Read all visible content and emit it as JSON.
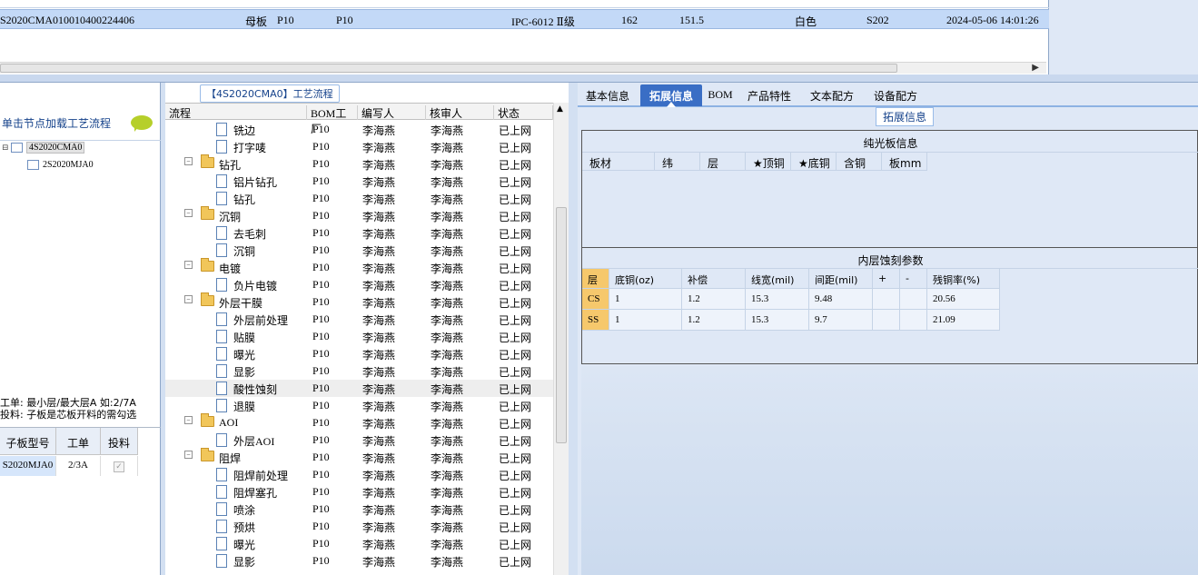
{
  "top_grid": {
    "row": {
      "code": "S2020CMA0",
      "id": "10010400224406",
      "board_type": "母板",
      "p1": "P10",
      "p2": "P10",
      "grade": "IPC-6012 Ⅱ级",
      "n1": "162",
      "n2": "151.5",
      "color": "白色",
      "s": "S202",
      "datetime": "2024-05-06 14:01:26"
    }
  },
  "left": {
    "title": "单击节点加载工艺流程",
    "tree": [
      {
        "label": "4S2020CMA0"
      },
      {
        "label": "2S2020MJA0"
      }
    ],
    "note1": "工单: 最小层/最大层A 如:2/7A",
    "note2": "投料: 子板是芯板开料的需勾选",
    "sub_headers": [
      "子板型号",
      "工单",
      "投料"
    ],
    "sub_row": {
      "model": "S2020MJA0",
      "order": "2/3A"
    }
  },
  "middle": {
    "legend": "【4S2020CMA0】工艺流程",
    "headers": [
      "流程",
      "BOM工厂",
      "编写人",
      "核审人",
      "状态"
    ],
    "rows": [
      {
        "name": "铣边",
        "level": 2,
        "bom": "P10",
        "writer": "李海燕",
        "reviewer": "李海燕",
        "status": "已上网"
      },
      {
        "name": "打字唛",
        "level": 2,
        "bom": "P10",
        "writer": "李海燕",
        "reviewer": "李海燕",
        "status": "已上网"
      },
      {
        "name": "钻孔",
        "level": 1,
        "bom": "P10",
        "writer": "李海燕",
        "reviewer": "李海燕",
        "status": "已上网"
      },
      {
        "name": "铝片钻孔",
        "level": 2,
        "bom": "P10",
        "writer": "李海燕",
        "reviewer": "李海燕",
        "status": "已上网"
      },
      {
        "name": "钻孔",
        "level": 2,
        "bom": "P10",
        "writer": "李海燕",
        "reviewer": "李海燕",
        "status": "已上网"
      },
      {
        "name": "沉铜",
        "level": 1,
        "bom": "P10",
        "writer": "李海燕",
        "reviewer": "李海燕",
        "status": "已上网"
      },
      {
        "name": "去毛刺",
        "level": 2,
        "bom": "P10",
        "writer": "李海燕",
        "reviewer": "李海燕",
        "status": "已上网"
      },
      {
        "name": "沉铜",
        "level": 2,
        "bom": "P10",
        "writer": "李海燕",
        "reviewer": "李海燕",
        "status": "已上网"
      },
      {
        "name": "电镀",
        "level": 1,
        "bom": "P10",
        "writer": "李海燕",
        "reviewer": "李海燕",
        "status": "已上网"
      },
      {
        "name": "负片电镀",
        "level": 2,
        "bom": "P10",
        "writer": "李海燕",
        "reviewer": "李海燕",
        "status": "已上网"
      },
      {
        "name": "外层干膜",
        "level": 1,
        "bom": "P10",
        "writer": "李海燕",
        "reviewer": "李海燕",
        "status": "已上网"
      },
      {
        "name": "外层前处理",
        "level": 2,
        "bom": "P10",
        "writer": "李海燕",
        "reviewer": "李海燕",
        "status": "已上网"
      },
      {
        "name": "贴膜",
        "level": 2,
        "bom": "P10",
        "writer": "李海燕",
        "reviewer": "李海燕",
        "status": "已上网"
      },
      {
        "name": "曝光",
        "level": 2,
        "bom": "P10",
        "writer": "李海燕",
        "reviewer": "李海燕",
        "status": "已上网"
      },
      {
        "name": "显影",
        "level": 2,
        "bom": "P10",
        "writer": "李海燕",
        "reviewer": "李海燕",
        "status": "已上网"
      },
      {
        "name": "酸性蚀刻",
        "level": 2,
        "bom": "P10",
        "writer": "李海燕",
        "reviewer": "李海燕",
        "status": "已上网"
      },
      {
        "name": "退膜",
        "level": 2,
        "bom": "P10",
        "writer": "李海燕",
        "reviewer": "李海燕",
        "status": "已上网"
      },
      {
        "name": "AOI",
        "level": 1,
        "bom": "P10",
        "writer": "李海燕",
        "reviewer": "李海燕",
        "status": "已上网"
      },
      {
        "name": "外层AOI",
        "level": 2,
        "bom": "P10",
        "writer": "李海燕",
        "reviewer": "李海燕",
        "status": "已上网"
      },
      {
        "name": "阻焊",
        "level": 1,
        "bom": "P10",
        "writer": "李海燕",
        "reviewer": "李海燕",
        "status": "已上网"
      },
      {
        "name": "阻焊前处理",
        "level": 2,
        "bom": "P10",
        "writer": "李海燕",
        "reviewer": "李海燕",
        "status": "已上网"
      },
      {
        "name": "阻焊塞孔",
        "level": 2,
        "bom": "P10",
        "writer": "李海燕",
        "reviewer": "李海燕",
        "status": "已上网"
      },
      {
        "name": "喷涂",
        "level": 2,
        "bom": "P10",
        "writer": "李海燕",
        "reviewer": "李海燕",
        "status": "已上网"
      },
      {
        "name": "预烘",
        "level": 2,
        "bom": "P10",
        "writer": "李海燕",
        "reviewer": "李海燕",
        "status": "已上网"
      },
      {
        "name": "曝光",
        "level": 2,
        "bom": "P10",
        "writer": "李海燕",
        "reviewer": "李海燕",
        "status": "已上网"
      },
      {
        "name": "显影",
        "level": 2,
        "bom": "P10",
        "writer": "李海燕",
        "reviewer": "李海燕",
        "status": "已上网"
      }
    ],
    "selected_row": 15
  },
  "right": {
    "tabs": [
      "基本信息",
      "拓展信息",
      "BOM",
      "产品特性",
      "文本配方",
      "设备配方"
    ],
    "active_tab": 1,
    "legend": "拓展信息",
    "bare_board_title": "纯光板信息",
    "bare_board_headers": [
      "板材",
      "纬",
      "层",
      "★顶铜",
      "★底铜",
      "含铜",
      "板mm"
    ],
    "etch_title": "内层蚀刻参数",
    "etch_headers": [
      "层",
      "底铜(oz)",
      "补偿",
      "线宽(mil)",
      "间距(mil)",
      "+",
      "-",
      "残铜率(%)"
    ],
    "etch_rows": [
      {
        "layer": "CS",
        "base": "1",
        "comp": "1.2",
        "width": "15.3",
        "gap": "9.48",
        "plus": "",
        "minus": "",
        "rate": "20.56"
      },
      {
        "layer": "SS",
        "base": "1",
        "comp": "1.2",
        "width": "15.3",
        "gap": "9.7",
        "plus": "",
        "minus": "",
        "rate": "21.09"
      }
    ]
  }
}
